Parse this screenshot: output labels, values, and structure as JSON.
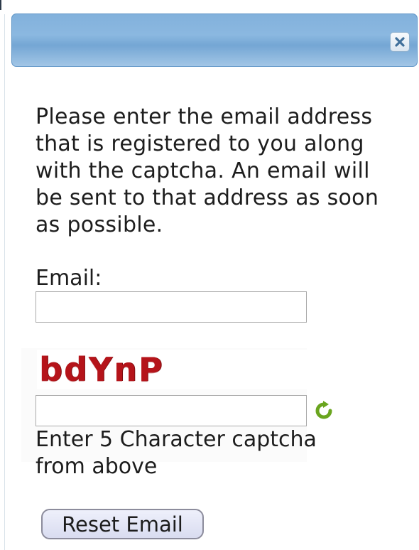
{
  "dialog": {
    "close_icon": "close-icon",
    "message": "Please enter the email address that is registered to you along with the captcha. An email will be sent to that address as soon as possible."
  },
  "form": {
    "email_label": "Email:",
    "email_value": "",
    "captcha_image_text": "bdYnP",
    "captcha_value": "",
    "refresh_icon": "refresh-icon",
    "captcha_hint": "Enter 5 Character captcha from above",
    "submit_label": "Reset Email"
  },
  "colors": {
    "header_blue": "#82b1dc",
    "captcha_red": "#b5141a",
    "refresh_green": "#6aa51f"
  }
}
